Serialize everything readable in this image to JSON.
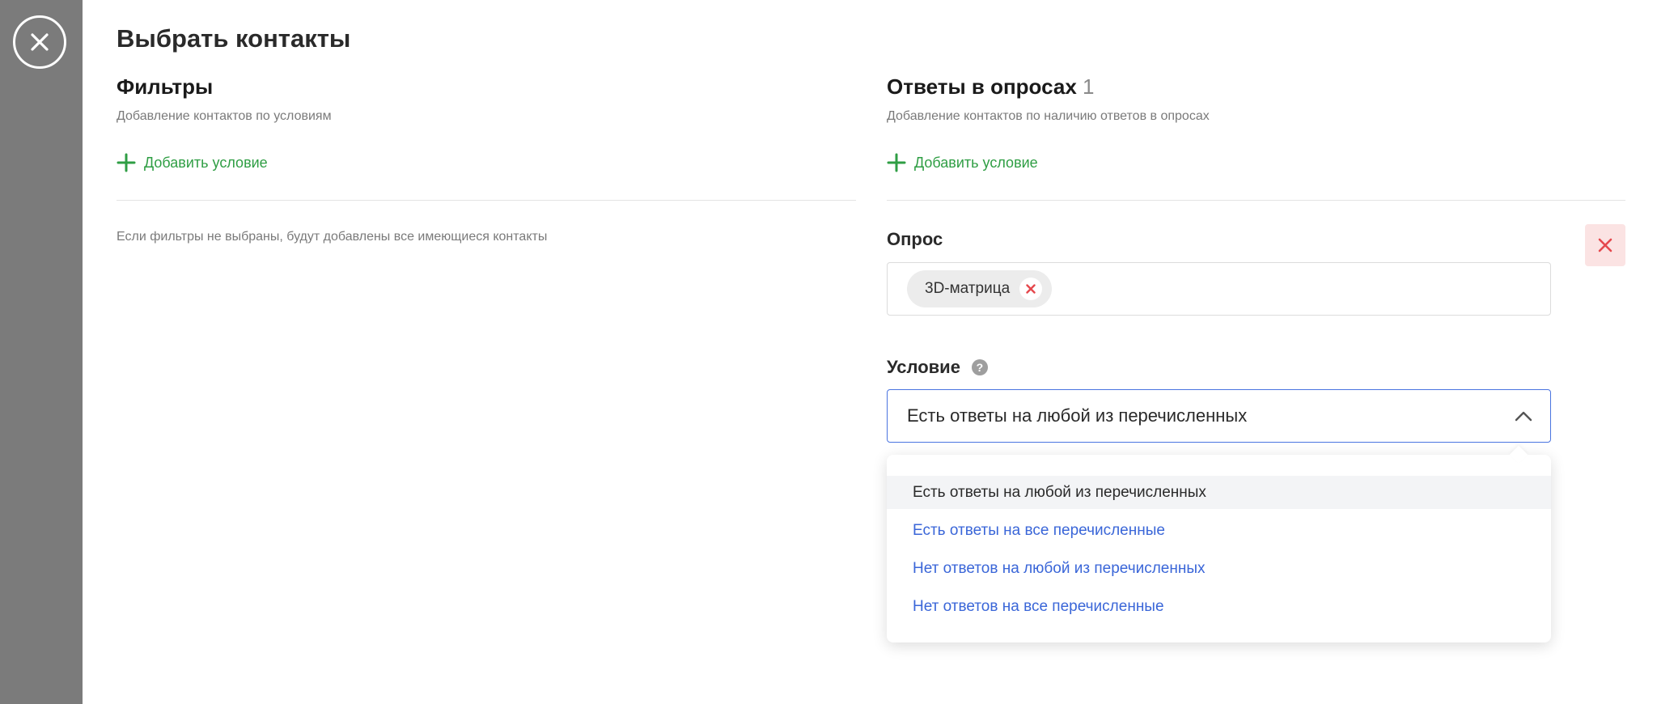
{
  "page": {
    "title": "Выбрать контакты"
  },
  "filters": {
    "title": "Фильтры",
    "description": "Добавление контактов по условиям",
    "add_label": "Добавить условие",
    "note": "Если фильтры не выбраны, будут добавлены все имеющиеся контакты"
  },
  "survey_answers": {
    "title": "Ответы в опросах",
    "count": "1",
    "description": "Добавление контактов по наличию ответов в опросах",
    "add_label": "Добавить условие",
    "survey_label": "Опрос",
    "selected_survey": "3D-матрица",
    "condition_label": "Условие",
    "condition_value": "Есть ответы на любой из перечисленных",
    "options": [
      "Есть ответы на любой из перечисленных",
      "Есть ответы на все перечисленные",
      "Нет ответов на любой из перечисленных",
      "Нет ответов на все перечисленные"
    ],
    "selected_option_index": 0
  },
  "colors": {
    "accent_green": "#2f9e44",
    "link_blue": "#3a66d8",
    "focus_border": "#4a74e0",
    "danger_red": "#e5484d",
    "danger_bg": "#fbe3e3",
    "overlay": "#7b7b7b"
  },
  "icons": {
    "close_panel": "close-circle-icon",
    "add": "plus-icon",
    "chip_remove": "x-icon",
    "remove_block": "x-icon",
    "help": "question-icon",
    "chevron": "chevron-up-icon"
  }
}
